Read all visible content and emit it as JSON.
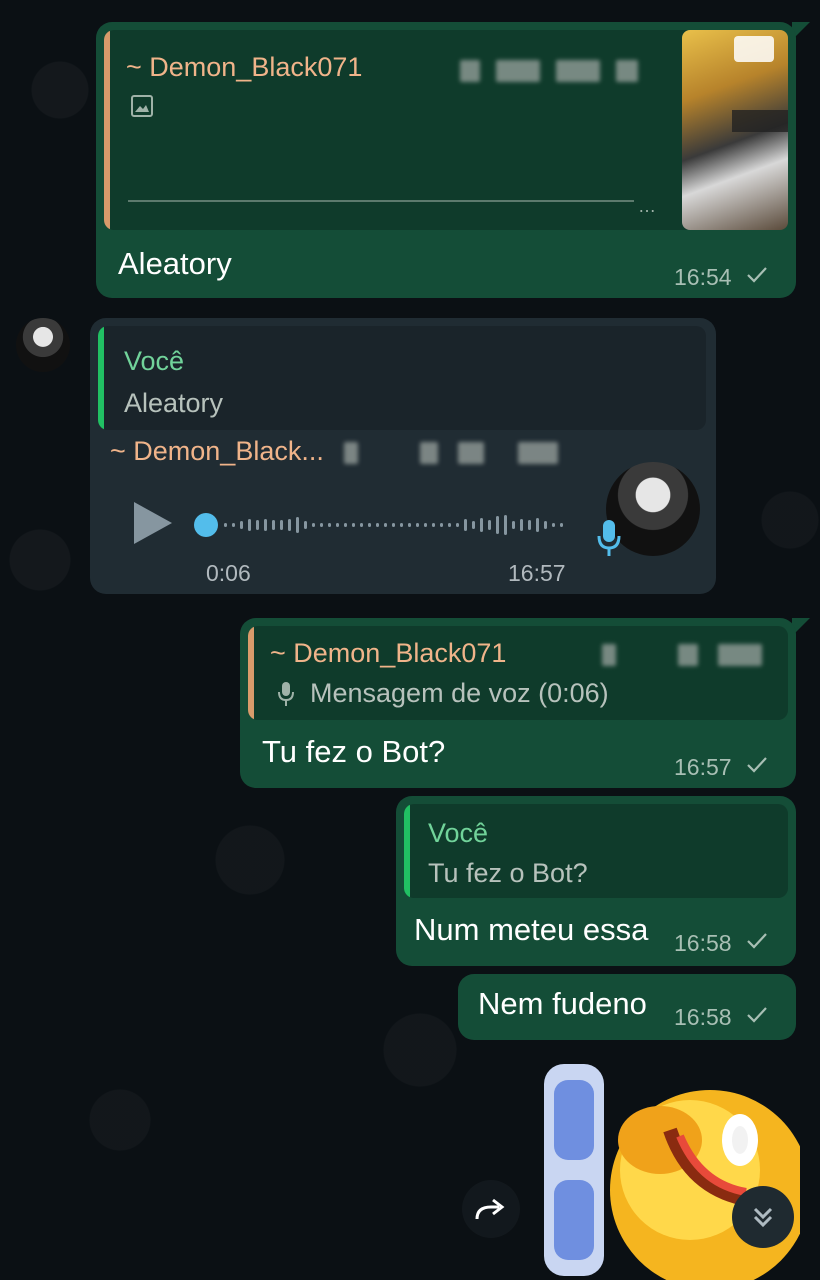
{
  "messages": {
    "m1": {
      "quoted_author": "~ Demon_Black071",
      "text": "Aleatory",
      "time": "16:54"
    },
    "m2": {
      "quoted_author": "Você",
      "quoted_text": "Aleatory",
      "sender": "~ Demon_Black...",
      "voice_duration": "0:06",
      "time": "16:57",
      "progress": 0
    },
    "m3": {
      "quoted_author": "~ Demon_Black071",
      "quoted_text": "Mensagem de voz (0:06)",
      "text": "Tu fez o Bot?",
      "time": "16:57"
    },
    "m4": {
      "quoted_author": "Você",
      "quoted_text": "Tu fez o Bot?",
      "text": "Num meteu essa",
      "time": "16:58"
    },
    "m5": {
      "text": "Nem fudeno",
      "time": "16:58"
    }
  },
  "icons": {
    "image": "image-icon",
    "tick": "single-check-icon",
    "mic": "mic-icon",
    "play": "play-icon",
    "forward": "forward-icon",
    "scroll_down": "double-chevron-down-icon"
  },
  "colors": {
    "outgoing_bubble": "#144d37",
    "incoming_bubble": "#202c33",
    "accent_green": "#21c063",
    "accent_orange": "#d89b6b",
    "voice_blue": "#53bdeb"
  }
}
